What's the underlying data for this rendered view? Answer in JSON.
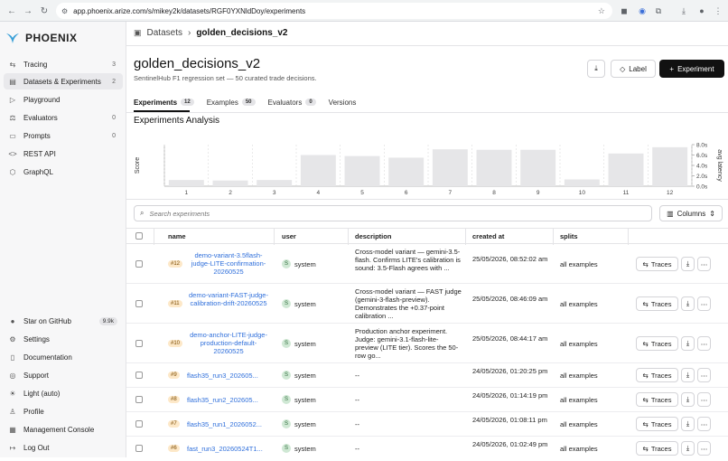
{
  "browser": {
    "url": "app.phoenix.arize.com/s/mikey2k/datasets/RGF0YXNldDoy/experiments"
  },
  "sidebar": {
    "logo": "PHOENIX",
    "items": [
      {
        "label": "Tracing",
        "count": "3"
      },
      {
        "label": "Datasets & Experiments",
        "count": "2"
      },
      {
        "label": "Playground",
        "count": ""
      },
      {
        "label": "Evaluators",
        "count": "0"
      },
      {
        "label": "Prompts",
        "count": "0"
      },
      {
        "label": "REST API",
        "count": ""
      },
      {
        "label": "GraphQL",
        "count": ""
      }
    ],
    "bottom": [
      {
        "label": "Star on GitHub",
        "badge": "9.9k"
      },
      {
        "label": "Settings"
      },
      {
        "label": "Documentation"
      },
      {
        "label": "Support"
      },
      {
        "label": "Light (auto)"
      },
      {
        "label": "Profile"
      },
      {
        "label": "Management Console"
      },
      {
        "label": "Log Out"
      }
    ]
  },
  "breadcrumb": {
    "root": "Datasets",
    "current": "golden_decisions_v2"
  },
  "page": {
    "title": "golden_decisions_v2",
    "subtitle": "SentinelHub F1 regression set — 50 curated trade decisions.",
    "label_button": "Label",
    "experiment_button": "Experiment"
  },
  "tabs": [
    {
      "label": "Experiments",
      "badge": "12"
    },
    {
      "label": "Examples",
      "badge": "50"
    },
    {
      "label": "Evaluators",
      "badge": "0"
    },
    {
      "label": "Versions",
      "badge": ""
    }
  ],
  "analysis_title": "Experiments Analysis",
  "chart_data": {
    "type": "bar",
    "categories": [
      "1",
      "2",
      "3",
      "4",
      "5",
      "6",
      "7",
      "8",
      "9",
      "10",
      "11",
      "12"
    ],
    "values": [
      1.2,
      1.1,
      1.2,
      6.0,
      5.8,
      5.5,
      7.1,
      7.0,
      7.0,
      1.3,
      6.3,
      7.5
    ],
    "ylabel": "Score",
    "y2label": "avg latency",
    "y2ticks": [
      "0.0s",
      "2.0s",
      "4.0s",
      "6.0s",
      "8.0s"
    ],
    "ylim": [
      0,
      8
    ],
    "bar_color": "#e6e6e8",
    "grid": true
  },
  "search": {
    "placeholder": "Search experiments",
    "columns_button": "Columns"
  },
  "table": {
    "headers": {
      "name": "name",
      "user": "user",
      "description": "description",
      "created": "created at",
      "splits": "splits"
    },
    "traces_label": "Traces",
    "rows": [
      {
        "seq": "#12",
        "name": "demo-variant-3.5flash-judge-LITE-confirmation-20260525",
        "user": "system",
        "avatar": "S",
        "description": "Cross-model variant — gemini-3.5-flash. Confirms LITE's calibration is sound: 3.5-Flash agrees with ...",
        "created": "25/05/2026, 08:52:02 am",
        "splits": "all examples"
      },
      {
        "seq": "#11",
        "name": "demo-variant-FAST-judge-calibration-drift-20260525",
        "user": "system",
        "avatar": "S",
        "description": "Cross-model variant — FAST judge (gemini-3-flash-preview). Demonstrates the +0.37-point calibration ...",
        "created": "25/05/2026, 08:46:09 am",
        "splits": "all examples"
      },
      {
        "seq": "#10",
        "name": "demo-anchor-LITE-judge-production-default-20260525",
        "user": "system",
        "avatar": "S",
        "description": "Production anchor experiment. Judge: gemini-3.1-flash-lite-preview (LITE tier). Scores the 50-row go...",
        "created": "25/05/2026, 08:44:17 am",
        "splits": "all examples"
      },
      {
        "seq": "#9",
        "name": "flash35_run3_202605...",
        "user": "system",
        "avatar": "S",
        "description": "--",
        "created": "24/05/2026, 01:20:25 pm",
        "splits": "all examples"
      },
      {
        "seq": "#8",
        "name": "flash35_run2_202605...",
        "user": "system",
        "avatar": "S",
        "description": "--",
        "created": "24/05/2026, 01:14:19 pm",
        "splits": "all examples"
      },
      {
        "seq": "#7",
        "name": "flash35_run1_2026052...",
        "user": "system",
        "avatar": "S",
        "description": "--",
        "created": "24/05/2026, 01:08:11 pm",
        "splits": "all examples"
      },
      {
        "seq": "#6",
        "name": "fast_run3_20260524T1...",
        "user": "system",
        "avatar": "S",
        "description": "--",
        "created": "24/05/2026, 01:02:49 pm",
        "splits": "all examples"
      }
    ]
  }
}
